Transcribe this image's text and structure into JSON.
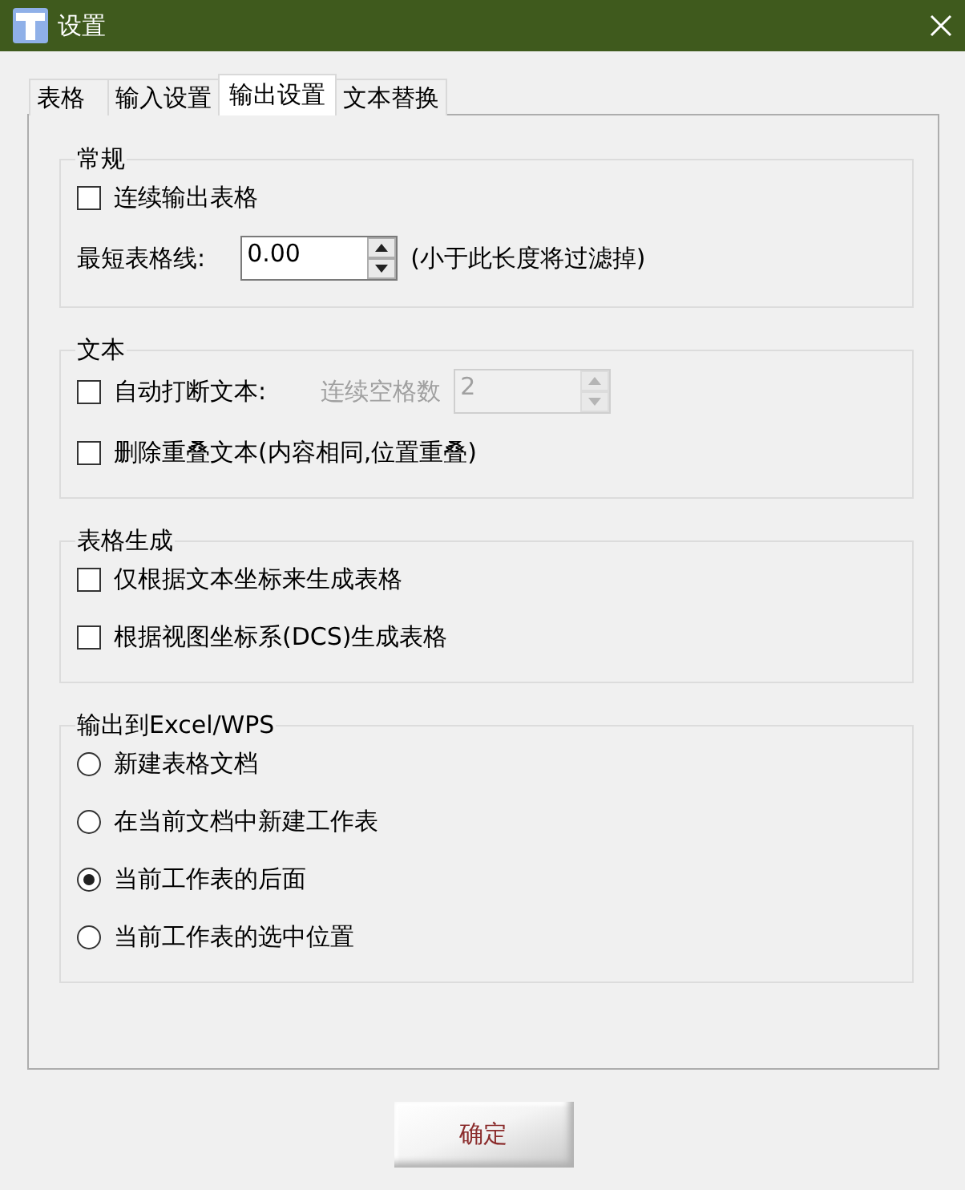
{
  "window": {
    "title": "设置"
  },
  "tabs": [
    {
      "label": "表格",
      "selected": false
    },
    {
      "label": "输入设置",
      "selected": false
    },
    {
      "label": "输出设置",
      "selected": true
    },
    {
      "label": "文本替换",
      "selected": false
    }
  ],
  "groups": [
    {
      "title": "常规",
      "items": [
        {
          "kind": "checkbox",
          "label": "连续输出表格",
          "checked": false
        },
        {
          "kind": "spin",
          "label": "最短表格线:",
          "value": "0.00",
          "note": "(小于此长度将过滤掉)",
          "disabled": false
        }
      ]
    },
    {
      "title": "文本",
      "items": [
        {
          "kind": "checkbox",
          "label": "自动打断文本:",
          "checked": false,
          "spin": {
            "label": "连续空格数",
            "value": "2",
            "disabled": true
          }
        },
        {
          "kind": "checkbox",
          "label": "删除重叠文本(内容相同,位置重叠)",
          "checked": false
        }
      ]
    },
    {
      "title": "表格生成",
      "items": [
        {
          "kind": "checkbox",
          "label": "仅根据文本坐标来生成表格",
          "checked": false
        },
        {
          "kind": "checkbox",
          "label": "根据视图坐标系(DCS)生成表格",
          "checked": false
        }
      ]
    },
    {
      "title": "输出到Excel/WPS",
      "items": [
        {
          "kind": "radio",
          "label": "新建表格文档",
          "selected": false
        },
        {
          "kind": "radio",
          "label": "在当前文档中新建工作表",
          "selected": false
        },
        {
          "kind": "radio",
          "label": "当前工作表的后面",
          "selected": true
        },
        {
          "kind": "radio",
          "label": "当前工作表的选中位置",
          "selected": false
        }
      ]
    }
  ],
  "buttons": [
    {
      "label": "确定"
    }
  ]
}
